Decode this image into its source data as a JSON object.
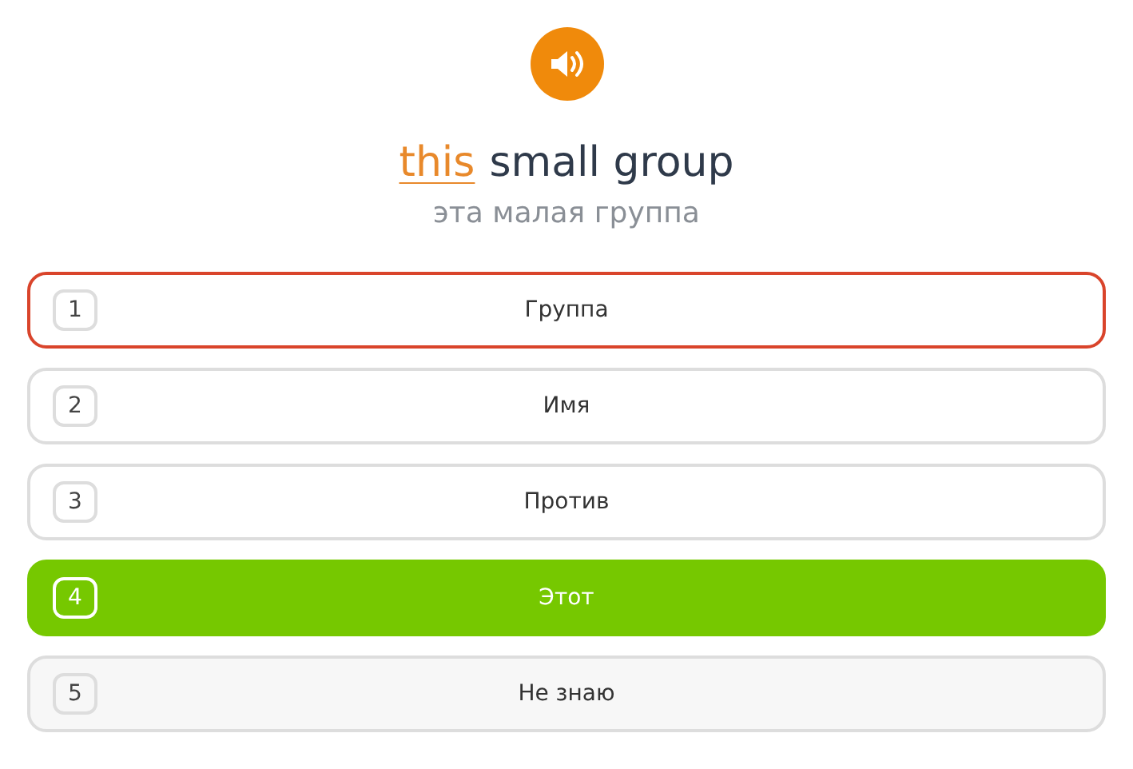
{
  "audio_button": {
    "playing": false
  },
  "phrase": {
    "parts": [
      {
        "text": "this",
        "highlighted": true
      },
      {
        "text": "small group",
        "highlighted": false
      }
    ],
    "translation": "эта малая группа"
  },
  "options": [
    {
      "number": "1",
      "label": "Группа",
      "kind": "answer",
      "wrong": true,
      "correct": false
    },
    {
      "number": "2",
      "label": "Имя",
      "kind": "answer",
      "wrong": false,
      "correct": false
    },
    {
      "number": "3",
      "label": "Против",
      "kind": "answer",
      "wrong": false,
      "correct": false
    },
    {
      "number": "4",
      "label": "Этот",
      "kind": "answer",
      "wrong": false,
      "correct": true
    },
    {
      "number": "5",
      "label": "Не знаю",
      "kind": "skip",
      "wrong": false,
      "correct": false
    }
  ]
}
